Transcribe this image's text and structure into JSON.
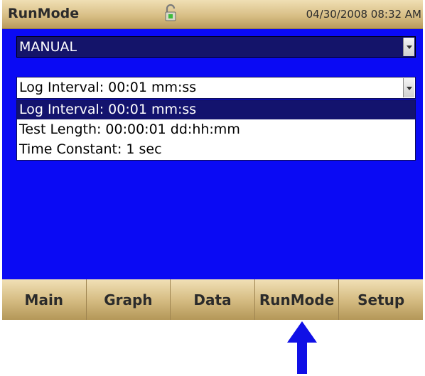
{
  "titlebar": {
    "title": "RunMode",
    "datetime": "04/30/2008 08:32 AM",
    "lock_icon": "unlocked-padlock-icon"
  },
  "mode_select": {
    "value": "MANUAL"
  },
  "interval_select": {
    "value": "Log Interval: 00:01 mm:ss",
    "options": [
      "Log Interval: 00:01 mm:ss",
      "Test Length: 00:00:01 dd:hh:mm",
      "Time Constant: 1 sec"
    ],
    "selected_index": 0
  },
  "nav": {
    "tabs": [
      "Main",
      "Graph",
      "Data",
      "RunMode",
      "Setup"
    ]
  },
  "colors": {
    "screen_background": "#0a0af4",
    "selected_option": "#13136e",
    "arrow": "#1010e6"
  }
}
